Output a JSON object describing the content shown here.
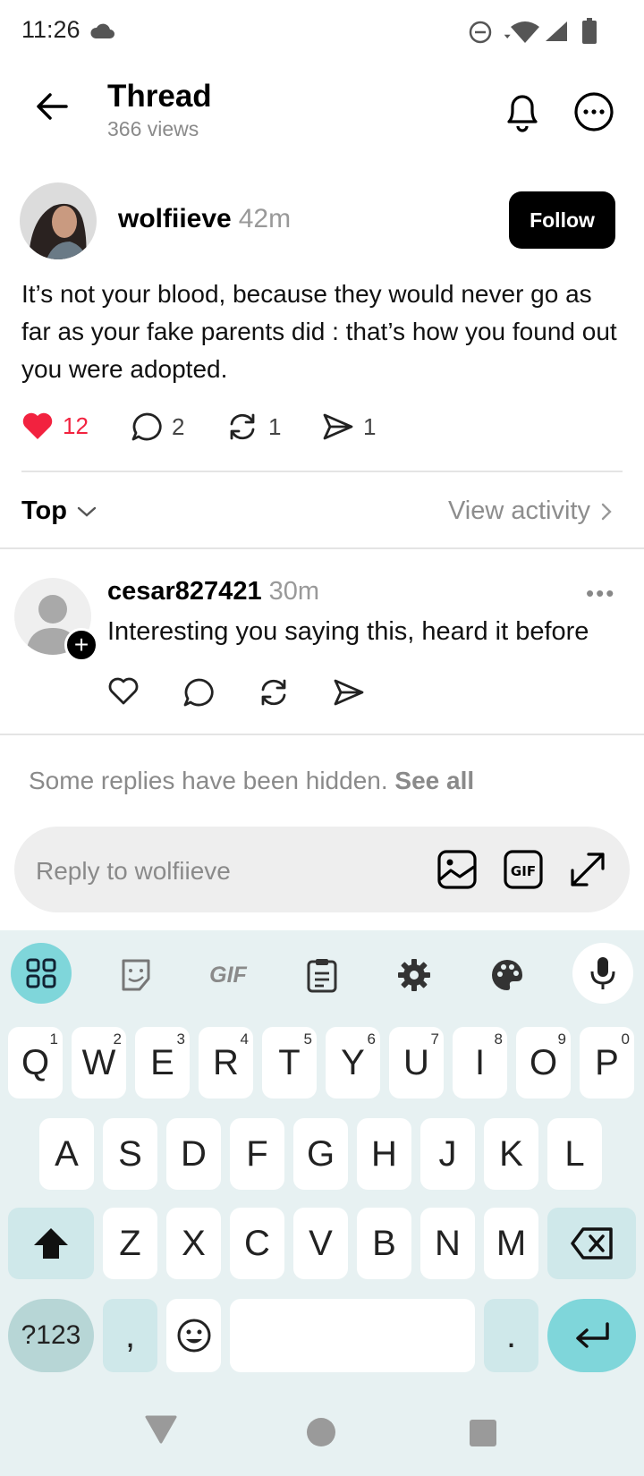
{
  "status_bar": {
    "time": "11:26"
  },
  "header": {
    "title": "Thread",
    "views": "366 views"
  },
  "post": {
    "username": "wolfiieve",
    "time": "42m",
    "follow_label": "Follow",
    "text": "It’s not your blood, because they would never go as far as your fake parents did : that’s how you found out you were adopted.",
    "likes": "12",
    "comments": "2",
    "reposts": "1",
    "shares": "1",
    "like_color": "#f2223f"
  },
  "sort": {
    "label": "Top",
    "view_activity": "View activity"
  },
  "reply": {
    "username": "cesar827421",
    "time": "30m",
    "more": "•••",
    "text": "Interesting you saying this, heard it before"
  },
  "hidden_note": {
    "text": "Some replies have been hidden.",
    "link": "See all"
  },
  "composer": {
    "placeholder": "Reply to wolfiieve"
  },
  "keyboard": {
    "toolbar": [
      "apps-grid-icon",
      "sticker-icon",
      "gif-icon",
      "clipboard-icon",
      "settings-gear-icon",
      "palette-icon",
      "microphone-icon"
    ],
    "gif_label": "GIF",
    "row1": [
      {
        "k": "Q",
        "h": "1"
      },
      {
        "k": "W",
        "h": "2"
      },
      {
        "k": "E",
        "h": "3"
      },
      {
        "k": "R",
        "h": "4"
      },
      {
        "k": "T",
        "h": "5"
      },
      {
        "k": "Y",
        "h": "6"
      },
      {
        "k": "U",
        "h": "7"
      },
      {
        "k": "I",
        "h": "8"
      },
      {
        "k": "O",
        "h": "9"
      },
      {
        "k": "P",
        "h": "0"
      }
    ],
    "row2": [
      "A",
      "S",
      "D",
      "F",
      "G",
      "H",
      "J",
      "K",
      "L"
    ],
    "row3": [
      "Z",
      "X",
      "C",
      "V",
      "B",
      "N",
      "M"
    ],
    "symbols": "?123",
    "comma": ",",
    "period": ".",
    "accent": "#7fd6da"
  }
}
